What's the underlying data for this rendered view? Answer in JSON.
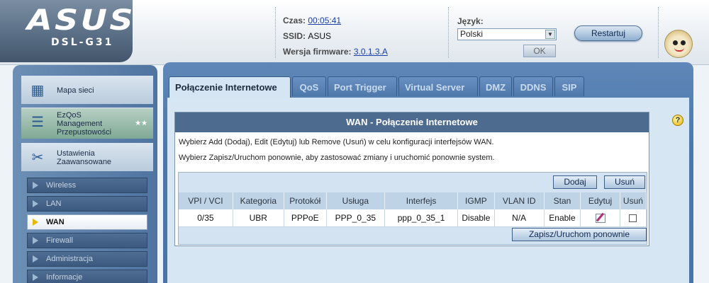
{
  "brand": {
    "logo": "ASUS",
    "model": "DSL-G31"
  },
  "status": {
    "time_label": "Czas:",
    "time_value": "00:05:41",
    "ssid_label": "SSID:",
    "ssid_value": "ASUS",
    "firmware_label": "Wersja firmware:",
    "firmware_value": "3.0.1.3.A"
  },
  "language": {
    "label": "Język:",
    "selected": "Polski",
    "ok_label": "OK"
  },
  "restart_label": "Restartuj",
  "sidebar": {
    "main_items": [
      {
        "label": "Mapa sieci",
        "icon": "network-map-icon"
      },
      {
        "label": "EzQoS Management Przepustowości",
        "icon": "qos-icon"
      },
      {
        "label": "Ustawienia Zaawansowane",
        "icon": "tools-icon"
      }
    ],
    "sub_items": [
      {
        "label": "Wireless",
        "active": false
      },
      {
        "label": "LAN",
        "active": false
      },
      {
        "label": "WAN",
        "active": true
      },
      {
        "label": "Firewall",
        "active": false
      },
      {
        "label": "Administracja",
        "active": false
      },
      {
        "label": "Informacje",
        "active": false
      }
    ]
  },
  "tabs": [
    "Połączenie Internetowe",
    "QoS",
    "Port Trigger",
    "Virtual Server",
    "DMZ",
    "DDNS",
    "SIP"
  ],
  "active_tab": "Połączenie Internetowe",
  "wan": {
    "title": "WAN - Połączenie Internetowe",
    "desc1": "Wybierz Add (Dodaj), Edit (Edytuj) lub Remove (Usuń) w celu konfiguracji interfejsów WAN.",
    "desc2": "Wybierz Zapisz/Uruchom ponownie, aby zastosować zmiany i uruchomić ponownie system.",
    "add_label": "Dodaj",
    "remove_label": "Usuń",
    "save_label": "Zapisz/Uruchom ponownie",
    "columns": [
      "VPI / VCI",
      "Kategoria",
      "Protokół",
      "Usługa",
      "Interfejs",
      "IGMP",
      "VLAN ID",
      "Stan",
      "Edytuj",
      "Usuń"
    ],
    "rows": [
      {
        "vpi_vci": "0/35",
        "category": "UBR",
        "protocol": "PPPoE",
        "service": "PPP_0_35",
        "interface": "ppp_0_35_1",
        "igmp": "Disable",
        "vlan_id": "N/A",
        "state": "Enable"
      }
    ]
  },
  "colors": {
    "accent": "#4d6b8f",
    "panel": "#4c77ab",
    "content_bg": "#d7e6f3"
  }
}
